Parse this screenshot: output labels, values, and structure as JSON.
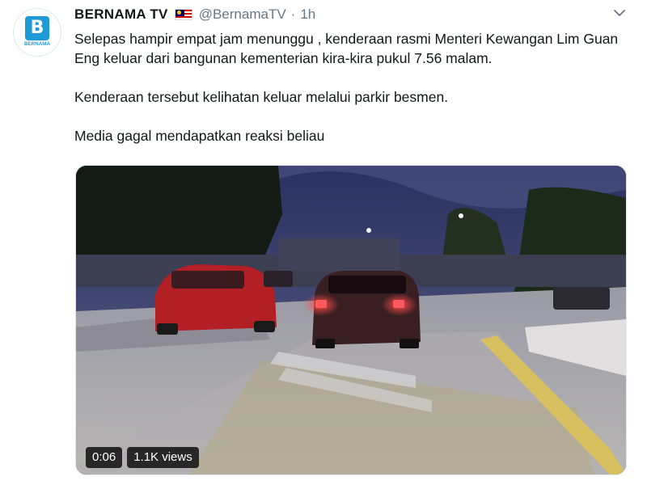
{
  "tweet": {
    "account_name": "BERNAMA TV",
    "handle": "@BernamaTV",
    "separator": "·",
    "time": "1h",
    "logo_text": "BERNAMA",
    "paragraphs": [
      "Selepas hampir empat jam menunggu , kenderaan rasmi Menteri Kewangan Lim Guan Eng keluar dari bangunan kementerian kira-kira pukul 7.56 malam.",
      "Kenderaan tersebut kelihatan keluar melalui parkir besmen.",
      "Media gagal mendapatkan reaksi beliau"
    ],
    "video": {
      "duration": "0:06",
      "views": "1.1K views"
    }
  },
  "icons": {
    "avatar": "bernama-logo-icon",
    "flag": "malaysia-flag-icon",
    "menu": "chevron-down-icon"
  },
  "colors": {
    "brand_blue": "#1e9ad6",
    "text": "#14171a",
    "secondary_text": "#657786"
  }
}
